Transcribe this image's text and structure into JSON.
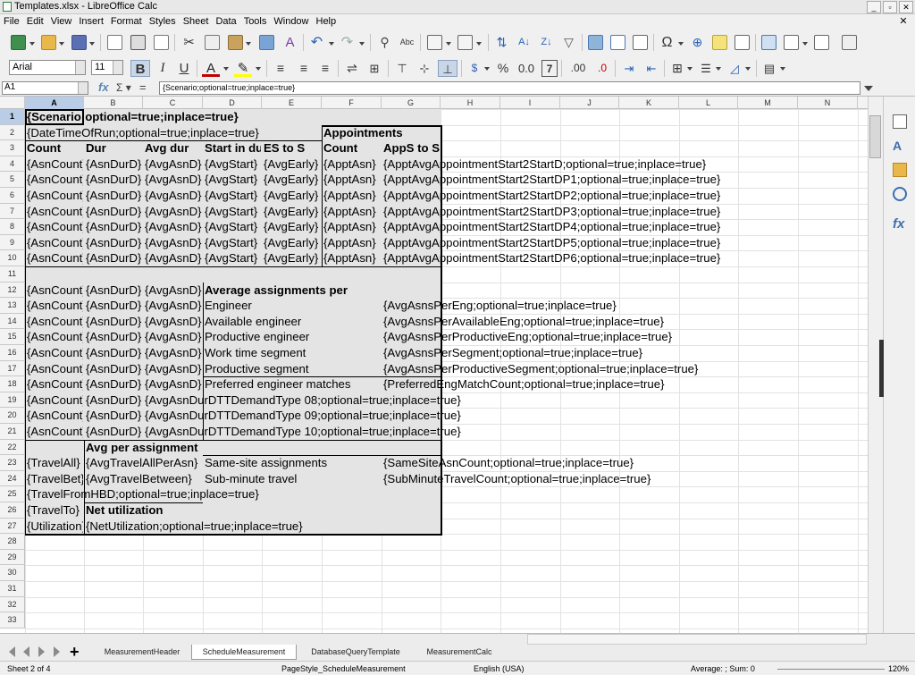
{
  "window": {
    "title": "Templates.xlsx - LibreOffice Calc",
    "min": "_",
    "max": "▫",
    "close": "✕"
  },
  "menu": [
    "File",
    "Edit",
    "View",
    "Insert",
    "Format",
    "Styles",
    "Sheet",
    "Data",
    "Tools",
    "Window",
    "Help"
  ],
  "menu_close": "✕",
  "toolbar2": {
    "font_name": "Arial",
    "font_size": "11",
    "bold": "B",
    "italic": "I",
    "underline": "U",
    "currency": "$",
    "percent": "%",
    "number": "0.0",
    "decimal_add": ".00",
    "decimal_remove": ".0"
  },
  "formula_bar": {
    "name_box": "A1",
    "fx": "fx",
    "sigma": "Σ ▾",
    "equals": "=",
    "content": "{Scenario;optional=true;inplace=true}"
  },
  "columns": [
    "A",
    "B",
    "C",
    "D",
    "E",
    "F",
    "G",
    "H",
    "I",
    "J",
    "K",
    "L",
    "M",
    "N"
  ],
  "selected_column": "A",
  "rows": [
    "1",
    "2",
    "3",
    "4",
    "5",
    "6",
    "7",
    "8",
    "9",
    "10",
    "11",
    "12",
    "13",
    "14",
    "15",
    "16",
    "17",
    "18",
    "19",
    "20",
    "21",
    "22",
    "23",
    "24",
    "25",
    "26",
    "27",
    "28",
    "29",
    "30",
    "31",
    "32",
    "33"
  ],
  "selected_row": "1",
  "cells": {
    "a1": "{Scenario;optional=true;inplace=true}",
    "a2": "{DateTimeOfRun;optional=true;inplace=true}",
    "f2": "Appointments",
    "a3": "Count",
    "b3": "Dur",
    "c3": "Avg dur",
    "d3": "Start in duration",
    "e3": "ES to S",
    "f3": "Count",
    "g3": "AppS to S",
    "a4": "{AsnCount}",
    "b4": "{AsnDurD}",
    "c4": "{AvgAsnD}",
    "d4": "{AvgStart}",
    "e4": "{AvgEarly}",
    "f4": "{ApptAsn}",
    "g4": "{ApptAvgAppointmentStart2StartD;optional=true;inplace=true}",
    "a5": "{AsnCount}",
    "b5": "{AsnDurD}",
    "c5": "{AvgAsnD}",
    "d5": "{AvgStart}",
    "e5": "{AvgEarly}",
    "f5": "{ApptAsn}",
    "g5": "{ApptAvgAppointmentStart2StartDP1;optional=true;inplace=true}",
    "a6": "{AsnCount}",
    "b6": "{AsnDurD}",
    "c6": "{AvgAsnD}",
    "d6": "{AvgStart}",
    "e6": "{AvgEarly}",
    "f6": "{ApptAsn}",
    "g6": "{ApptAvgAppointmentStart2StartDP2;optional=true;inplace=true}",
    "a7": "{AsnCount}",
    "b7": "{AsnDurD}",
    "c7": "{AvgAsnD}",
    "d7": "{AvgStart}",
    "e7": "{AvgEarly}",
    "f7": "{ApptAsn}",
    "g7": "{ApptAvgAppointmentStart2StartDP3;optional=true;inplace=true}",
    "a8": "{AsnCount}",
    "b8": "{AsnDurD}",
    "c8": "{AvgAsnD}",
    "d8": "{AvgStart}",
    "e8": "{AvgEarly}",
    "f8": "{ApptAsn}",
    "g8": "{ApptAvgAppointmentStart2StartDP4;optional=true;inplace=true}",
    "a9": "{AsnCount}",
    "b9": "{AsnDurD}",
    "c9": "{AvgAsnD}",
    "d9": "{AvgStart}",
    "e9": "{AvgEarly}",
    "f9": "{ApptAsn}",
    "g9": "{ApptAvgAppointmentStart2StartDP5;optional=true;inplace=true}",
    "a10": "{AsnCount}",
    "b10": "{AsnDurD}",
    "c10": "{AvgAsnD}",
    "d10": "{AvgStart}",
    "e10": "{AvgEarly}",
    "f10": "{ApptAsn}",
    "g10": "{ApptAvgAppointmentStart2StartDP6;optional=true;inplace=true}",
    "a12": "{AsnCount}",
    "b12": "{AsnDurD}",
    "c12": "{AvgAsnD}",
    "d12": "Average assignments per",
    "a13": "{AsnCount}",
    "b13": "{AsnDurD}",
    "c13": "{AvgAsnD}",
    "d13": "Engineer",
    "g13": "{AvgAsnsPerEng;optional=true;inplace=true}",
    "a14": "{AsnCount}",
    "b14": "{AsnDurD}",
    "c14": "{AvgAsnD}",
    "d14": "Available engineer",
    "g14": "{AvgAsnsPerAvailableEng;optional=true;inplace=true}",
    "a15": "{AsnCount}",
    "b15": "{AsnDurD}",
    "c15": "{AvgAsnD}",
    "d15": "Productive engineer",
    "g15": "{AvgAsnsPerProductiveEng;optional=true;inplace=true}",
    "a16": "{AsnCount}",
    "b16": "{AsnDurD}",
    "c16": "{AvgAsnD}",
    "d16": "Work time segment",
    "g16": "{AvgAsnsPerSegment;optional=true;inplace=true}",
    "a17": "{AsnCount}",
    "b17": "{AsnDurD}",
    "c17": "{AvgAsnD}",
    "d17": "Productive segment",
    "g17": "{AvgAsnsPerProductiveSegment;optional=true;inplace=true}",
    "a18": "{AsnCount}",
    "b18": "{AsnDurD}",
    "c18": "{AvgAsnD}",
    "d18": "Preferred engineer matches",
    "g18": "{PreferredEngMatchCount;optional=true;inplace=true}",
    "a19": "{AsnCount}",
    "b19": "{AsnDurD}",
    "c19": "{AvgAsnDurDTTDemandType 08;optional=true;inplace=true}",
    "a20": "{AsnCount}",
    "b20": "{AsnDurD}",
    "c20": "{AvgAsnDurDTTDemandType 09;optional=true;inplace=true}",
    "a21": "{AsnCount}",
    "b21": "{AsnDurD}",
    "c21": "{AvgAsnDurDTTDemandType 10;optional=true;inplace=true}",
    "b22": "Avg per assignment",
    "a23": "{TravelAll}",
    "b23": "{AvgTravelAllPerAsn}",
    "d23": "Same-site assignments",
    "g23": "{SameSiteAsnCount;optional=true;inplace=true}",
    "a24": "{TravelBet}",
    "b24": "{AvgTravelBetween}",
    "d24": "Sub-minute travel",
    "g24": "{SubMinuteTravelCount;optional=true;inplace=true}",
    "a25": "{TravelFromHBD;optional=true;inplace=true}",
    "a26": "{TravelTo}",
    "b26": "Net utilization",
    "a27": "{Utilization}",
    "b27": "{NetUtilization;optional=true;inplace=true}"
  },
  "sheet_tabs": [
    "MeasurementHeader",
    "ScheduleMeasurement",
    "DatabaseQueryTemplate",
    "MeasurementCalc"
  ],
  "active_tab": "ScheduleMeasurement",
  "status": {
    "sheet": "Sheet 2 of 4",
    "page_style": "PageStyle_ScheduleMeasurement",
    "language": "English (USA)",
    "summary": "Average: ; Sum: 0",
    "zoom": "120%"
  },
  "colors": {
    "selected_header": "#b9cde6",
    "shaded_range": "#e4e4e4",
    "grid_line": "#e2e2e2",
    "accent_blue": "#3a6fb0"
  }
}
